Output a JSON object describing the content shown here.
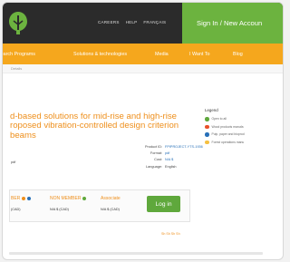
{
  "header": {
    "links": [
      "CAREERS",
      "HELP",
      "FRANÇAIS"
    ],
    "signin_label": "Sign In / New Accoun"
  },
  "nav": {
    "items": [
      "Search Programs",
      "Solutions & technologies",
      "Media",
      "I Want To",
      "Blog"
    ]
  },
  "breadcrumb": "Details",
  "product": {
    "title_line1": "d-based solutions for mid-rise and high-rise",
    "title_line2": "roposed vibration-controlled design criterion",
    "title_line3": "beams",
    "meta_labels": [
      "Product ID:",
      "Format:",
      "Cost:",
      "Language:"
    ],
    "product_id": "FPIPROJECT-YTS-1936",
    "format": "pdf",
    "cost": "N/A $",
    "language": "English",
    "pdf_label": "pdf"
  },
  "pricing": {
    "member_label": "BER",
    "member_price": "(CAD)",
    "nonmember_label": "NON MEMBER",
    "nonmember_price": "N/A $ (CAD)",
    "associate_label": "Associate",
    "associate_price": "N/A $ (CAD)",
    "login_label": "Log in",
    "footnote": "Sh Sh Sh Sh"
  },
  "legend": {
    "title": "Legend",
    "items": [
      {
        "label": "Open to all",
        "color": "#5fa83c"
      },
      {
        "label": "Wood products manufa",
        "color": "#e8502a"
      },
      {
        "label": "Pulp, paper and bioprod",
        "color": "#2870b8"
      },
      {
        "label": "Forest operations manu",
        "color": "#f5c040"
      }
    ]
  },
  "colors": {
    "brand_green": "#6cb33f",
    "nav_orange": "#f5a71d",
    "title_orange": "#ee8f1c",
    "topbar_dark": "#2b2b2b"
  }
}
